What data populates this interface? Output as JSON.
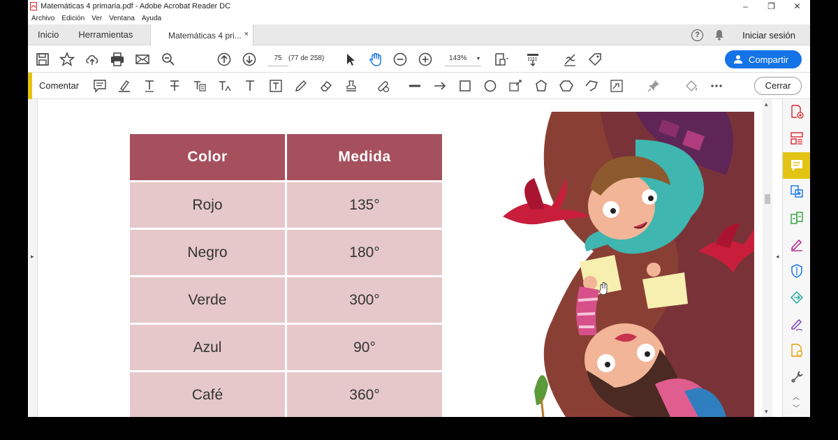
{
  "window": {
    "title": "Matemáticas 4 primaria.pdf - Adobe Acrobat Reader DC",
    "minimize": "‒",
    "restore": "❐",
    "close": "✕"
  },
  "menu": [
    "Archivo",
    "Edición",
    "Ver",
    "Ventana",
    "Ayuda"
  ],
  "tabs": {
    "home": "Inicio",
    "tools": "Herramientas",
    "document": "Matemáticas 4 pri...",
    "close": "×",
    "signin": "Iniciar sesión",
    "help": "?"
  },
  "toolbar": {
    "page_number": "75",
    "page_of": "(77 de 258)",
    "zoom": "143%",
    "zoom_caret": "▾",
    "share": "Compartir"
  },
  "comment_bar": {
    "label": "Comentar",
    "close": "Cerrar"
  },
  "table": {
    "headers": [
      "Color",
      "Medida"
    ],
    "rows": [
      [
        "Rojo",
        "135°"
      ],
      [
        "Negro",
        "180°"
      ],
      [
        "Verde",
        "300°"
      ],
      [
        "Azul",
        "90°"
      ],
      [
        "Café",
        "360°"
      ]
    ]
  },
  "colors": {
    "accent_yellow": "#e3c313",
    "share_blue": "#1473e6",
    "table_header": "#a6505d",
    "table_cell": "#e6c8ca",
    "pdf_red": "#d9232d"
  }
}
